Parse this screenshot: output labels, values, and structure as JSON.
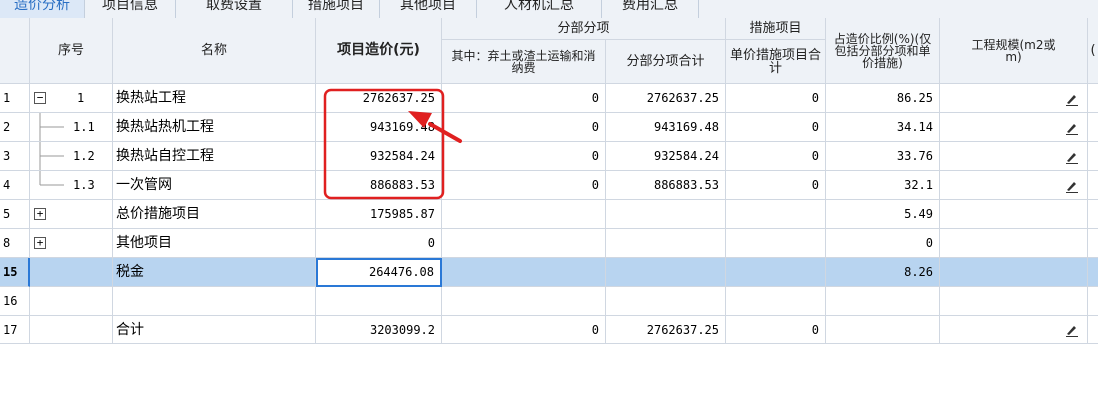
{
  "tabs": [
    "造价分析",
    "项目信息",
    "取费设置",
    "措施项目",
    "其他项目",
    "人材机汇总",
    "费用汇总"
  ],
  "active_tab_index": 0,
  "headers": {
    "seq": "序号",
    "name": "名称",
    "cost": "项目造价(元)",
    "fenbu_group": "分部分项",
    "fenbu_sub1": "其中：弃土或渣土运输和消纳费",
    "fenbu_sub2": "分部分项合计",
    "cuoshi_group": "措施项目",
    "cuoshi_sub": "单价措施项目合计",
    "ratio": "占造价比例(%)(仅包括分部分项和单价措施)",
    "scale": "工程规模(m2或m)",
    "extra": "("
  },
  "rows": [
    {
      "row": "1",
      "seq": "1",
      "name": "换热站工程",
      "cost": "2762637.25",
      "disposal": "0",
      "fenbu_total": "2762637.25",
      "cuoshi": "0",
      "ratio": "86.25",
      "toggle": "−",
      "edit": true
    },
    {
      "row": "2",
      "seq": "1.1",
      "name": "换热站热机工程",
      "cost": "943169.48",
      "disposal": "0",
      "fenbu_total": "943169.48",
      "cuoshi": "0",
      "ratio": "34.14",
      "edit": true
    },
    {
      "row": "3",
      "seq": "1.2",
      "name": "换热站自控工程",
      "cost": "932584.24",
      "disposal": "0",
      "fenbu_total": "932584.24",
      "cuoshi": "0",
      "ratio": "33.76",
      "edit": true
    },
    {
      "row": "4",
      "seq": "1.3",
      "name": "一次管网",
      "cost": "886883.53",
      "disposal": "0",
      "fenbu_total": "886883.53",
      "cuoshi": "0",
      "ratio": "32.1",
      "edit": true
    },
    {
      "row": "5",
      "seq": "",
      "name": "总价措施项目",
      "cost": "175985.87",
      "disposal": "",
      "fenbu_total": "",
      "cuoshi": "",
      "ratio": "5.49",
      "toggle": "+",
      "edit": false
    },
    {
      "row": "8",
      "seq": "",
      "name": "其他项目",
      "cost": "0",
      "disposal": "",
      "fenbu_total": "",
      "cuoshi": "",
      "ratio": "0",
      "toggle": "+",
      "edit": false
    },
    {
      "row": "15",
      "seq": "",
      "name": "税金",
      "cost": "264476.08",
      "disposal": "",
      "fenbu_total": "",
      "cuoshi": "",
      "ratio": "8.26",
      "edit": false,
      "selected": true
    },
    {
      "row": "16",
      "seq": "",
      "name": "",
      "cost": "",
      "disposal": "",
      "fenbu_total": "",
      "cuoshi": "",
      "ratio": "",
      "edit": false
    },
    {
      "row": "17",
      "seq": "",
      "name": "合计",
      "cost": "3203099.2",
      "disposal": "0",
      "fenbu_total": "2762637.25",
      "cuoshi": "0",
      "ratio": "",
      "edit": true
    }
  ],
  "colors": {
    "highlight": "#e02020",
    "selection": "#b8d4f0",
    "tab_active": "#2a6fc4"
  }
}
